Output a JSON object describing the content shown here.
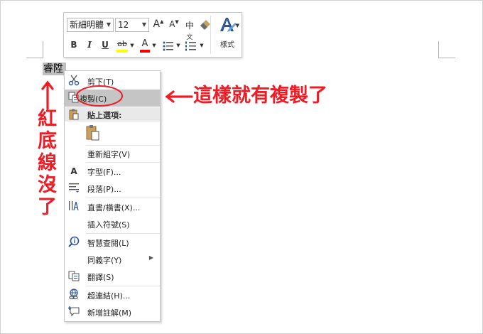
{
  "document": {
    "selected_text": "睿陞"
  },
  "mini_toolbar": {
    "font_name": "新細明體",
    "font_size": "12",
    "grow_font": "A",
    "shrink_font": "A",
    "phonetic": "中",
    "bold": "B",
    "italic": "I",
    "underline": "U",
    "highlight": "ab",
    "font_color": "A",
    "styles_label": "樣式"
  },
  "context_menu": {
    "cut": "剪下(T)",
    "copy": "複製(C)",
    "paste_options": "貼上選項:",
    "reconvert": "重新組字(V)",
    "font": "字型(F)...",
    "paragraph": "段落(P)...",
    "text_direction": "直書/橫書(X)...",
    "insert_symbol": "插入符號(S)",
    "smart_lookup": "智慧查閱(L)",
    "synonyms": "同義字(Y)",
    "translate": "翻譯(S)",
    "hyperlink": "超連結(H)...",
    "new_comment": "新增註解(M)"
  },
  "annotations": {
    "copy_note": "這樣就有複製了",
    "underline_note": "紅底線沒了"
  },
  "colors": {
    "annotation_red": "#ee1c25",
    "highlight_bar": "#ffff00",
    "font_color_bar": "#ff0000",
    "menu_highlight": "#c5c5c5"
  }
}
